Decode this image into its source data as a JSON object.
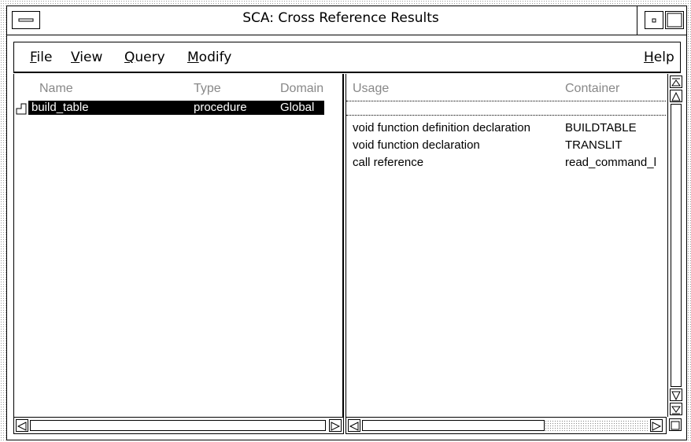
{
  "window": {
    "title": "SCA: Cross Reference Results"
  },
  "menubar": {
    "items": [
      {
        "label": "File",
        "mnemonic": "F"
      },
      {
        "label": "View",
        "mnemonic": "V"
      },
      {
        "label": "Query",
        "mnemonic": "Q"
      },
      {
        "label": "Modify",
        "mnemonic": "M"
      }
    ],
    "help": {
      "label": "Help",
      "mnemonic": "H"
    }
  },
  "left_pane": {
    "columns": [
      "Name",
      "Type",
      "Domain"
    ],
    "rows": [
      {
        "name": "build_table",
        "type": "procedure",
        "domain": "Global",
        "selected": true
      }
    ]
  },
  "right_pane": {
    "columns": [
      "Usage",
      "Container"
    ],
    "rows": [
      {
        "usage": "void function definition declaration",
        "container": "BUILDTABLE"
      },
      {
        "usage": "void function declaration",
        "container": "TRANSLIT"
      },
      {
        "usage": "call reference",
        "container": "read_command_l"
      }
    ]
  },
  "colors": {
    "selection_bg": "#000000",
    "selection_fg": "#ffffff",
    "header_text": "#888888"
  },
  "icons": [
    "window-menu-icon",
    "minimize-icon",
    "maximize-icon",
    "tree-node-icon",
    "scroll-left-arrow-icon",
    "scroll-right-arrow-icon",
    "scroll-up-arrow-icon",
    "scroll-down-arrow-icon",
    "scroll-top-icon",
    "scroll-bottom-icon",
    "expand-icon"
  ]
}
